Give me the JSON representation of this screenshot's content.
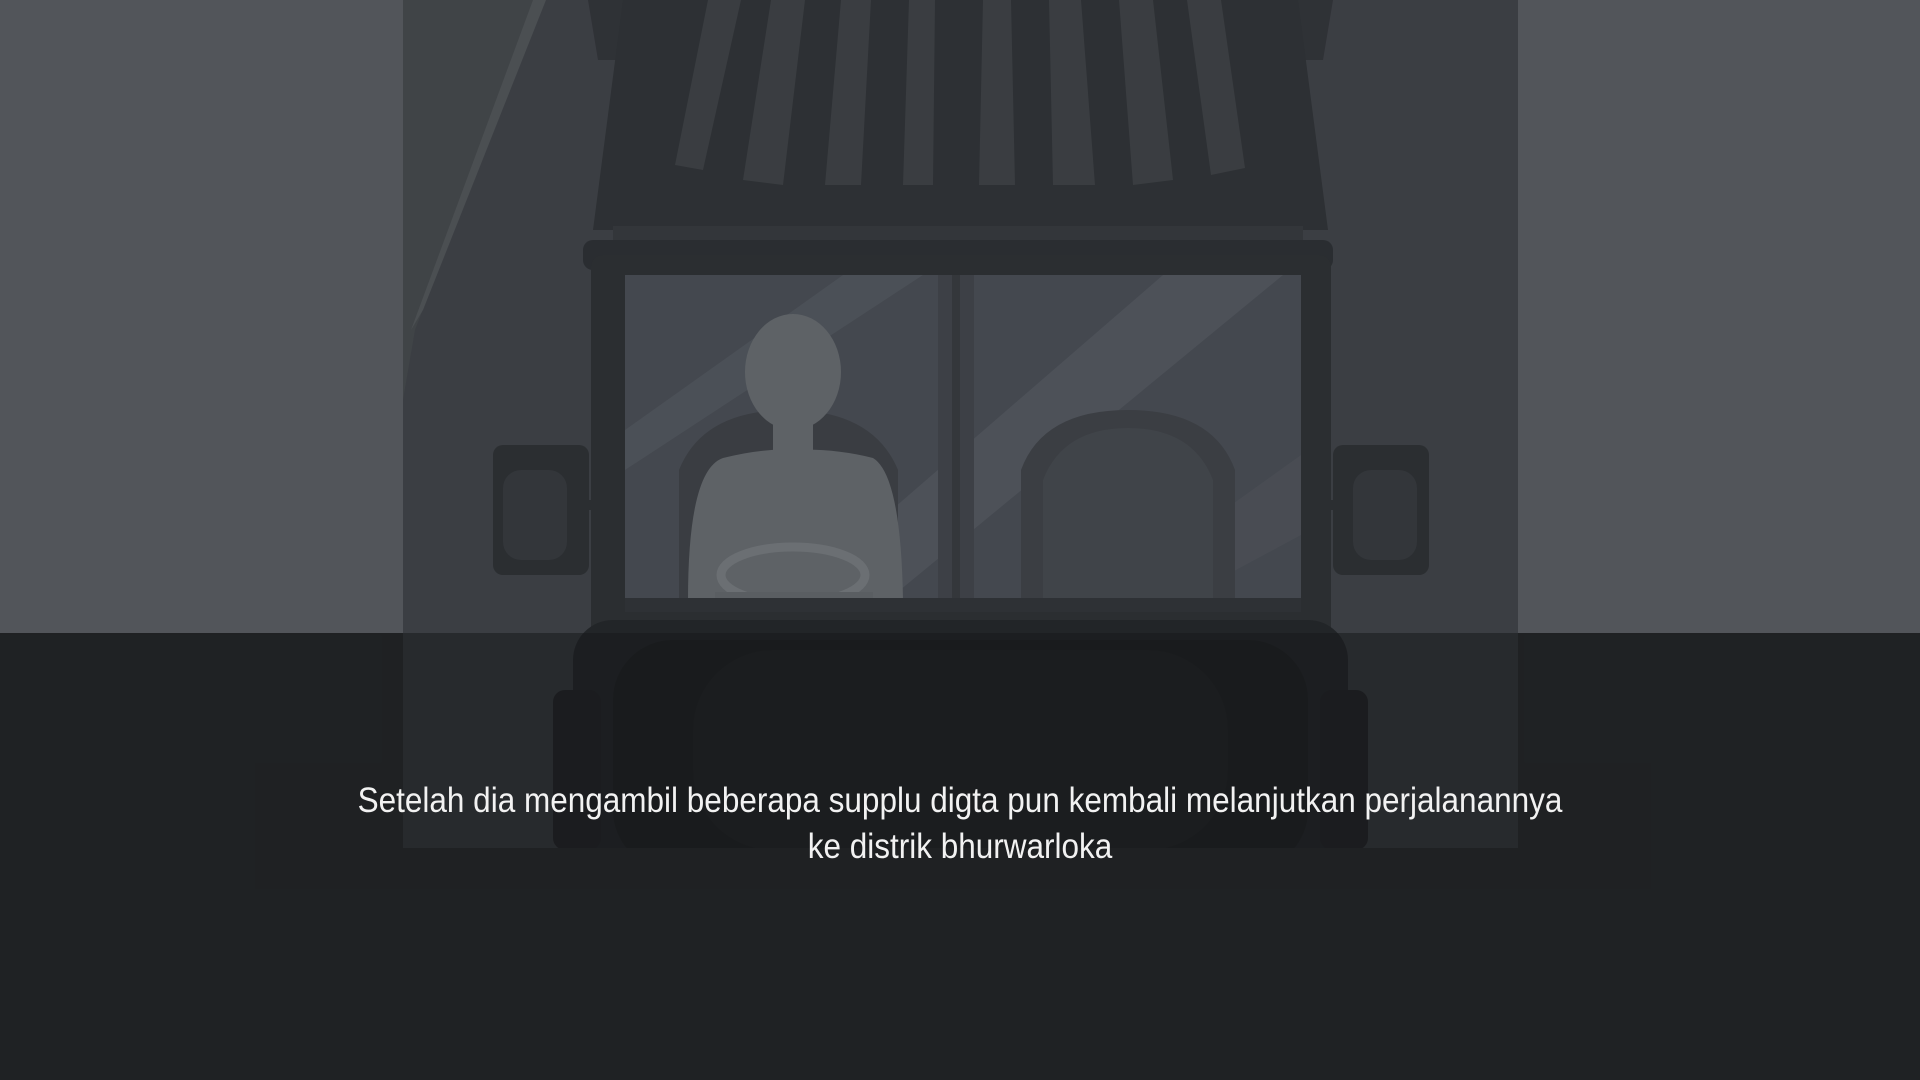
{
  "scene": {
    "name": "truck-cab-night",
    "colors": {
      "background_upper": "#52555a",
      "background_lower": "#282b2e",
      "panel": "#3b3e43",
      "truck_dark": "#2b2e31",
      "glass": "#464a52",
      "driver_silhouette": "#5e6266",
      "caption_text": "#f2f2f2"
    }
  },
  "dialogue": {
    "line1": "Setelah dia mengambil beberapa supplu digta pun kembali melanjutkan perjalanannya",
    "line2": "ke distrik bhurwarloka"
  }
}
